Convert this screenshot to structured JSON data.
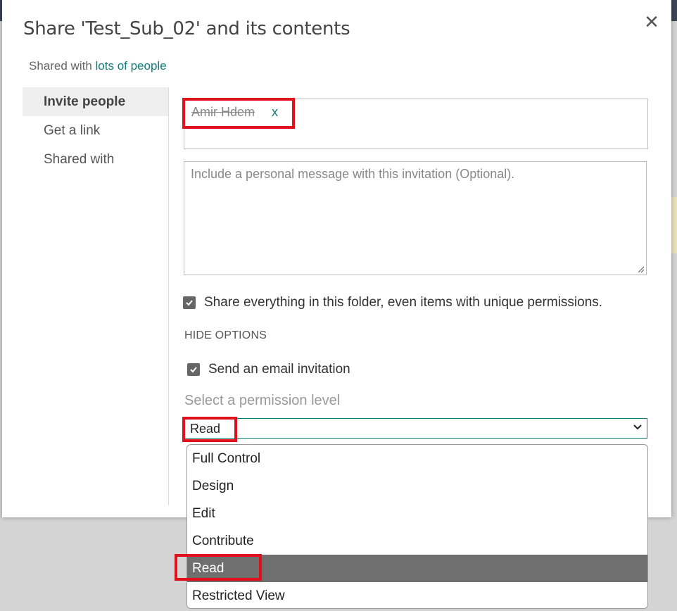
{
  "dialog": {
    "title": "Share 'Test_Sub_02' and its contents",
    "close_glyph": "✕",
    "shared_with_prefix": "Shared with",
    "shared_with_link": "lots of people"
  },
  "nav": {
    "items": [
      {
        "label": "Invite people",
        "active": true
      },
      {
        "label": "Get a link",
        "active": false
      },
      {
        "label": "Shared with",
        "active": false
      }
    ]
  },
  "invite": {
    "people_token": "Amir Hdem",
    "remove_token": "x",
    "message_placeholder": "Include a personal message with this invitation (Optional).",
    "share_everything_label": "Share everything in this folder, even items with unique permissions.",
    "share_everything_checked": true,
    "hide_options_label": "HIDE OPTIONS",
    "send_email_label": "Send an email invitation",
    "send_email_checked": true,
    "permission_label": "Select a permission level",
    "permission_value": "Read"
  },
  "dropdown": {
    "options": [
      "Full Control",
      "Design",
      "Edit",
      "Contribute",
      "Read",
      "Restricted View"
    ],
    "selected": "Read"
  },
  "colors": {
    "accent": "#0f7b7b",
    "highlight_box": "#e0101c",
    "selected_option_bg": "#6f6f6f"
  },
  "icons": {
    "close": "close-icon",
    "checkbox": "checkmark-icon",
    "chevron": "chevron-down-icon",
    "resize": "resize-grip-icon"
  }
}
